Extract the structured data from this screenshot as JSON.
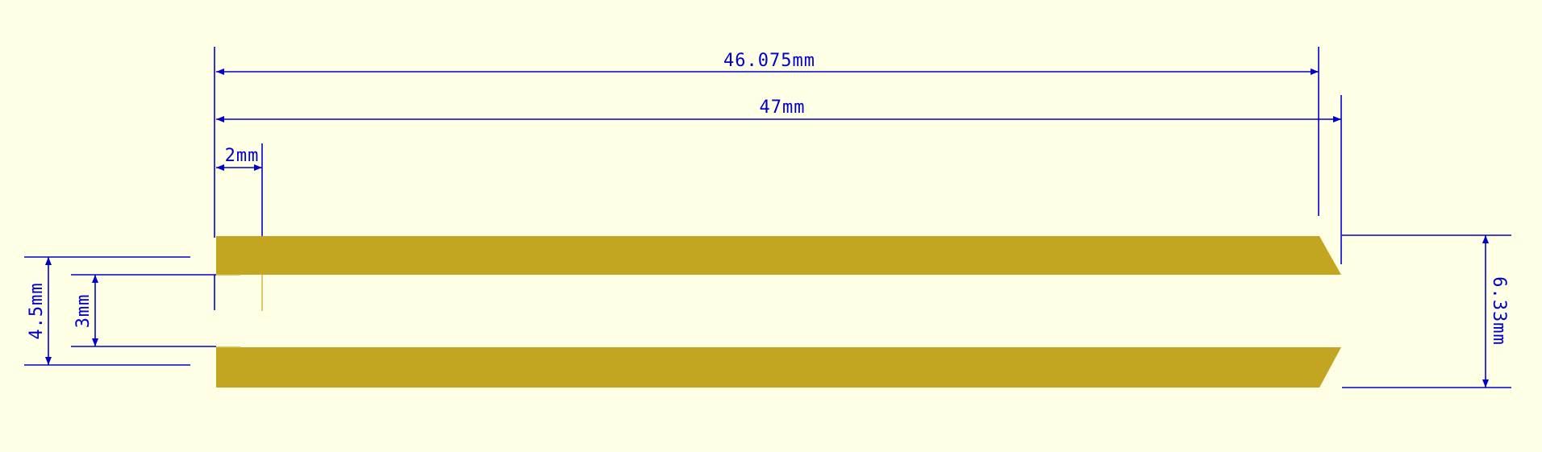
{
  "colors": {
    "background": "#ffffe5",
    "part": "#c2a521",
    "dimension": "#0000cc",
    "guide": "#c8a830"
  },
  "dimensions": {
    "overall_inner_length": "46.075mm",
    "overall_length": "47mm",
    "chamfer_length": "2mm",
    "outer_gap": "4.5mm",
    "inner_gap": "3mm",
    "total_height": "6.33mm"
  }
}
